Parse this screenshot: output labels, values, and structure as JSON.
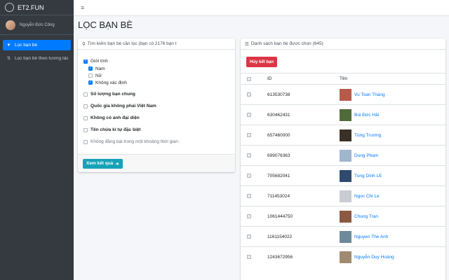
{
  "brand": {
    "name": "ET2.FUN"
  },
  "user": {
    "name": "Nguyễn Đức Công"
  },
  "sidebar": {
    "items": [
      {
        "label": "Lọc bạn bè",
        "active": true
      },
      {
        "label": "Lọc bạn bè theo tương tác",
        "active": false
      }
    ]
  },
  "page": {
    "title": "LỌC BẠN BÈ"
  },
  "filter_card": {
    "header": "Tìm kiếm bạn bè cần lọc (bạn có 2176 bạn t",
    "gender_label": "Giới tính",
    "gender_options": [
      {
        "label": "Nam",
        "checked": true
      },
      {
        "label": "Nữ",
        "checked": false
      },
      {
        "label": "Không xác định",
        "checked": true
      }
    ],
    "options": [
      "Số lượng bạn chung",
      "Quốc gia không phải Việt Nam",
      "Không có ảnh đại diện",
      "Tên chứa kí tự đặc biệt",
      "Không đăng bài trong một khoảng thời gian :"
    ],
    "submit_label": "Xem kết quả"
  },
  "list_card": {
    "header": "Danh sách bạn bè được chọn (645)",
    "unfriend_label": "Hủy kết bạn",
    "columns": {
      "id": "ID",
      "name": "Tên"
    },
    "rows": [
      {
        "id": "613530738",
        "name": "Vu Toan Thang",
        "thumb_color": "#b85a4a"
      },
      {
        "id": "630462431",
        "name": "Bùi Đức Hải",
        "thumb_color": "#4f6b3a"
      },
      {
        "id": "657460000",
        "name": "Tùng Trương",
        "thumb_color": "#3a3026"
      },
      {
        "id": "699076363",
        "name": "Dung Pham",
        "thumb_color": "#9fb6cc"
      },
      {
        "id": "705682041",
        "name": "Tung Dinh LE",
        "thumb_color": "#2f4a6e"
      },
      {
        "id": "711453024",
        "name": "Ngoc Chi Le",
        "thumb_color": "#c9ccd2"
      },
      {
        "id": "1061444750",
        "name": "Chung Tran",
        "thumb_color": "#8a5a42"
      },
      {
        "id": "1161154022",
        "name": "Nguyen The Anh",
        "thumb_color": "#6d8a9a"
      },
      {
        "id": "1243672956",
        "name": "Nguyễn Duy Hoàng",
        "thumb_color": "#a08a70"
      }
    ]
  },
  "colors": {
    "accent": "#007bff",
    "teal": "#17a2b8",
    "danger": "#dc3545",
    "sidebar": "#343a40"
  }
}
